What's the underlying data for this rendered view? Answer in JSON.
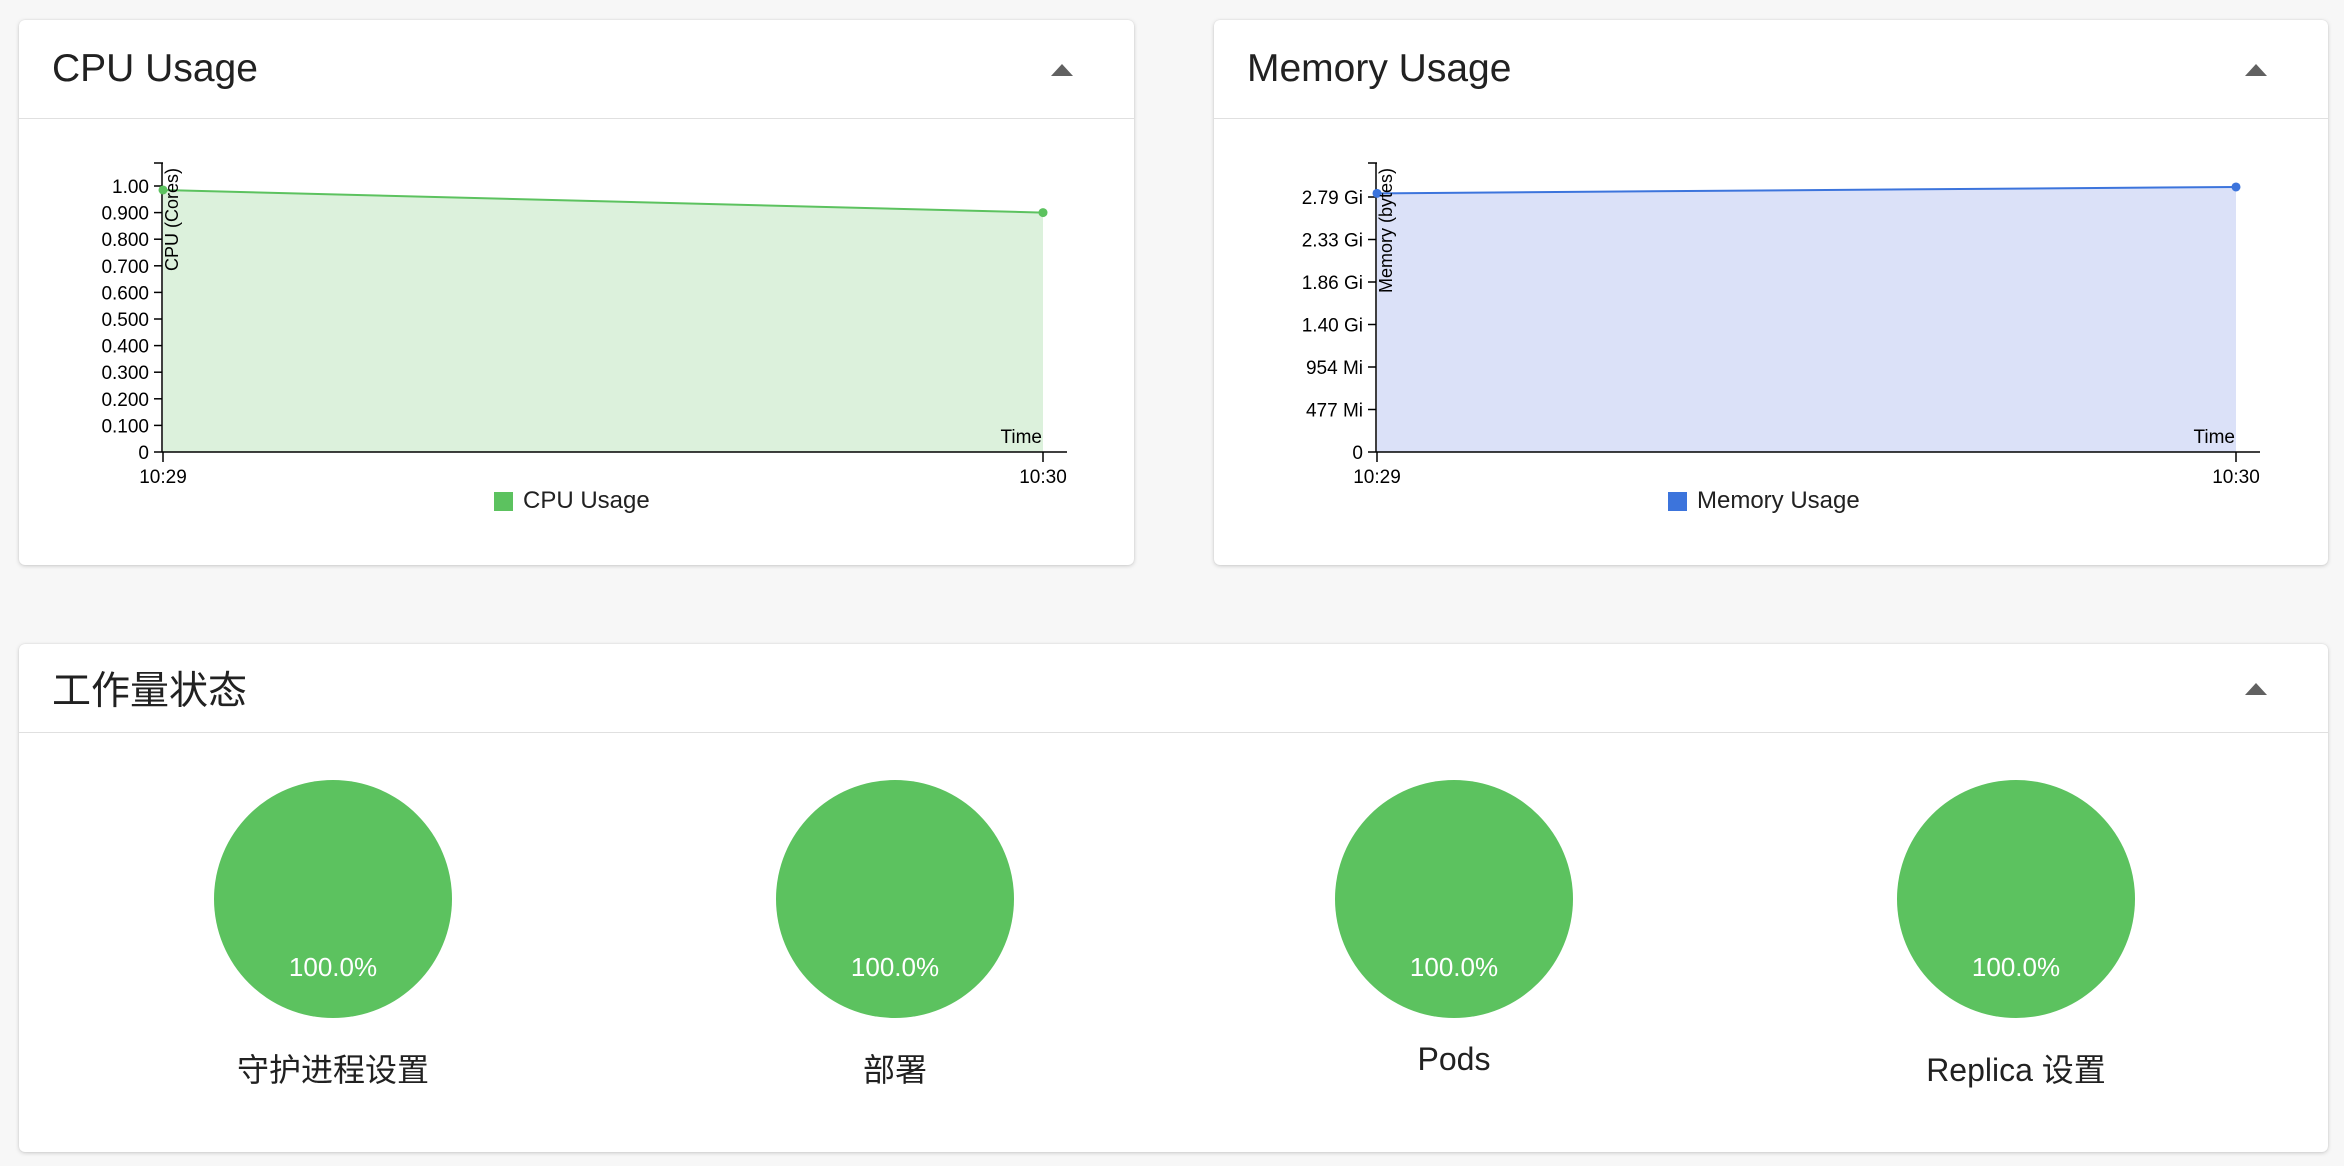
{
  "cpu_card": {
    "title": "CPU Usage"
  },
  "memory_card": {
    "title": "Memory Usage"
  },
  "workload_card": {
    "title": "工作量状态"
  },
  "colors": {
    "cpu": "#5cc25f",
    "cpu_fill": "#dcf1dc",
    "memory": "#3c74dc",
    "memory_fill": "#dbe1f8",
    "donut": "#5cc25f"
  },
  "chart_data": [
    {
      "type": "area",
      "title": "CPU Usage",
      "xlabel": "Time",
      "ylabel": "CPU (Cores)",
      "x": [
        "10:29",
        "10:30"
      ],
      "series": [
        {
          "name": "CPU Usage",
          "values": [
            0.985,
            0.9
          ]
        }
      ],
      "ylim": [
        0,
        1.0
      ],
      "yticks": [
        "0",
        "0.100",
        "0.200",
        "0.300",
        "0.400",
        "0.500",
        "0.600",
        "0.700",
        "0.800",
        "0.900",
        "1.00"
      ],
      "legend": "bottom"
    },
    {
      "type": "area",
      "title": "Memory Usage",
      "xlabel": "Time",
      "ylabel": "Memory (bytes)",
      "x": [
        "10:29",
        "10:30"
      ],
      "series": [
        {
          "name": "Memory Usage",
          "values": [
            2.83,
            2.9
          ]
        }
      ],
      "ylim": [
        0,
        2.79
      ],
      "yticks": [
        "0",
        "477 Mi",
        "954 Mi",
        "1.40 Gi",
        "1.86 Gi",
        "2.33 Gi",
        "2.79 Gi"
      ],
      "legend": "bottom"
    },
    {
      "type": "pie",
      "title": "工作量状态",
      "items": [
        {
          "label": "守护进程设置",
          "value": 100.0,
          "text": "100.0%"
        },
        {
          "label": "部署",
          "value": 100.0,
          "text": "100.0%"
        },
        {
          "label": "Pods",
          "value": 100.0,
          "text": "100.0%"
        },
        {
          "label": "Replica 设置",
          "value": 100.0,
          "text": "100.0%"
        }
      ]
    }
  ]
}
